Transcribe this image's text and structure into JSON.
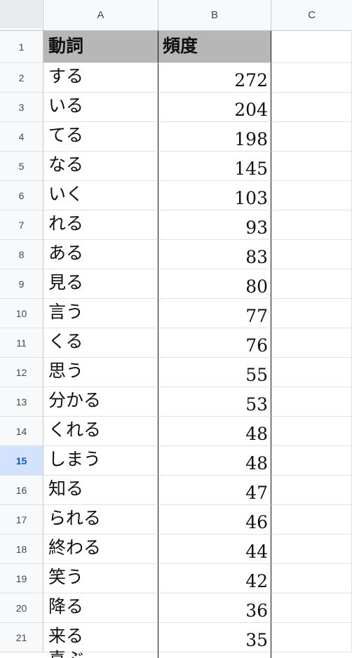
{
  "columns": [
    "A",
    "B",
    "C"
  ],
  "header": {
    "verb": "動詞",
    "freq": "頻度"
  },
  "active_row": 15,
  "rows": [
    {
      "n": "2",
      "verb": "する",
      "freq": "272"
    },
    {
      "n": "3",
      "verb": "いる",
      "freq": "204"
    },
    {
      "n": "4",
      "verb": "てる",
      "freq": "198"
    },
    {
      "n": "5",
      "verb": "なる",
      "freq": "145"
    },
    {
      "n": "6",
      "verb": "いく",
      "freq": "103"
    },
    {
      "n": "7",
      "verb": "れる",
      "freq": "93"
    },
    {
      "n": "8",
      "verb": "ある",
      "freq": "83"
    },
    {
      "n": "9",
      "verb": "見る",
      "freq": "80"
    },
    {
      "n": "10",
      "verb": "言う",
      "freq": "77"
    },
    {
      "n": "11",
      "verb": "くる",
      "freq": "76"
    },
    {
      "n": "12",
      "verb": "思う",
      "freq": "55"
    },
    {
      "n": "13",
      "verb": "分かる",
      "freq": "53"
    },
    {
      "n": "14",
      "verb": "くれる",
      "freq": "48"
    },
    {
      "n": "15",
      "verb": "しまう",
      "freq": "48"
    },
    {
      "n": "16",
      "verb": "知る",
      "freq": "47"
    },
    {
      "n": "17",
      "verb": "られる",
      "freq": "46"
    },
    {
      "n": "18",
      "verb": "終わる",
      "freq": "44"
    },
    {
      "n": "19",
      "verb": "笑う",
      "freq": "42"
    },
    {
      "n": "20",
      "verb": "降る",
      "freq": "36"
    },
    {
      "n": "21",
      "verb": "来る",
      "freq": "35"
    }
  ],
  "partial_next_row_text": "喜ぶ"
}
